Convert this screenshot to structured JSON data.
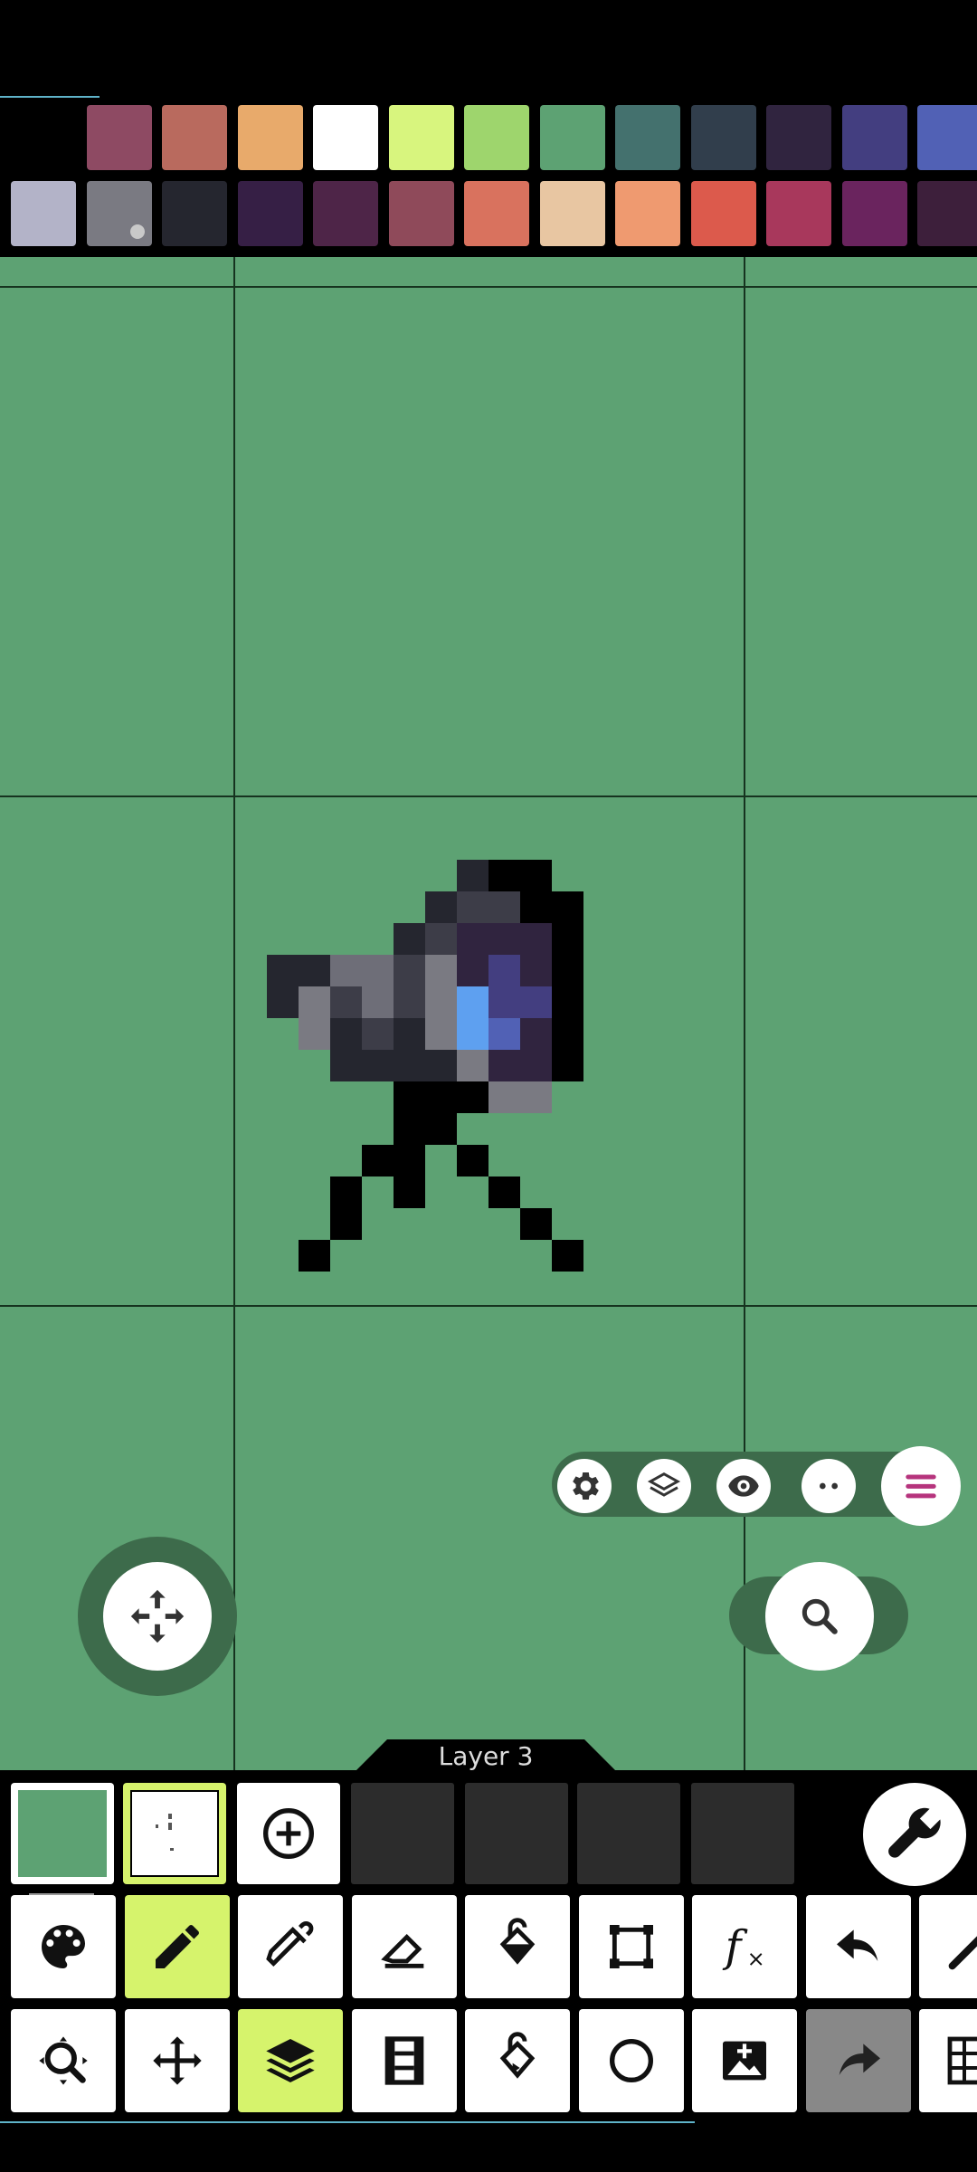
{
  "palette": {
    "row1": [
      "#000000",
      "#8e4a63",
      "#b96a5e",
      "#e8aa6b",
      "#ffffff",
      "#d8f57e",
      "#9ed56d",
      "#5da273",
      "#44716e",
      "#313e4c",
      "#30243f",
      "#433e80",
      "#5161b5"
    ],
    "row2": [
      "#b3b3c8",
      "#7a7a82",
      "#25262f",
      "#361f45",
      "#4e2548",
      "#8f4a5a",
      "#d9725e",
      "#e8c6a2",
      "#ef9a70",
      "#dc5a4c",
      "#a8385c",
      "#6a245e",
      "#3d1f3b"
    ],
    "selected_primary": "#000000",
    "selected_secondary": "#7a7a82"
  },
  "canvas": {
    "background": "#5da273",
    "quick_bar": [
      {
        "name": "settings-icon"
      },
      {
        "name": "layers-icon"
      },
      {
        "name": "eye-icon"
      },
      {
        "name": "more-icon"
      },
      {
        "name": "menu-icon"
      }
    ]
  },
  "layer": {
    "label": "Layer 3",
    "current_color": "#5da273"
  },
  "tools": {
    "row1": [
      "palette-icon",
      "pencil-icon",
      "eyedropper-icon",
      "eraser-icon",
      "fill-bucket-icon",
      "select-rect-icon",
      "function-icon",
      "undo-icon",
      "magic-wand-icon"
    ],
    "row2": [
      "zoom-icon",
      "move-icon",
      "layers-icon",
      "frames-icon",
      "fill-pattern-icon",
      "circle-icon",
      "add-image-icon",
      "redo-icon",
      "grid-icon"
    ],
    "active": [
      "pencil-icon",
      "layers-icon"
    ]
  }
}
